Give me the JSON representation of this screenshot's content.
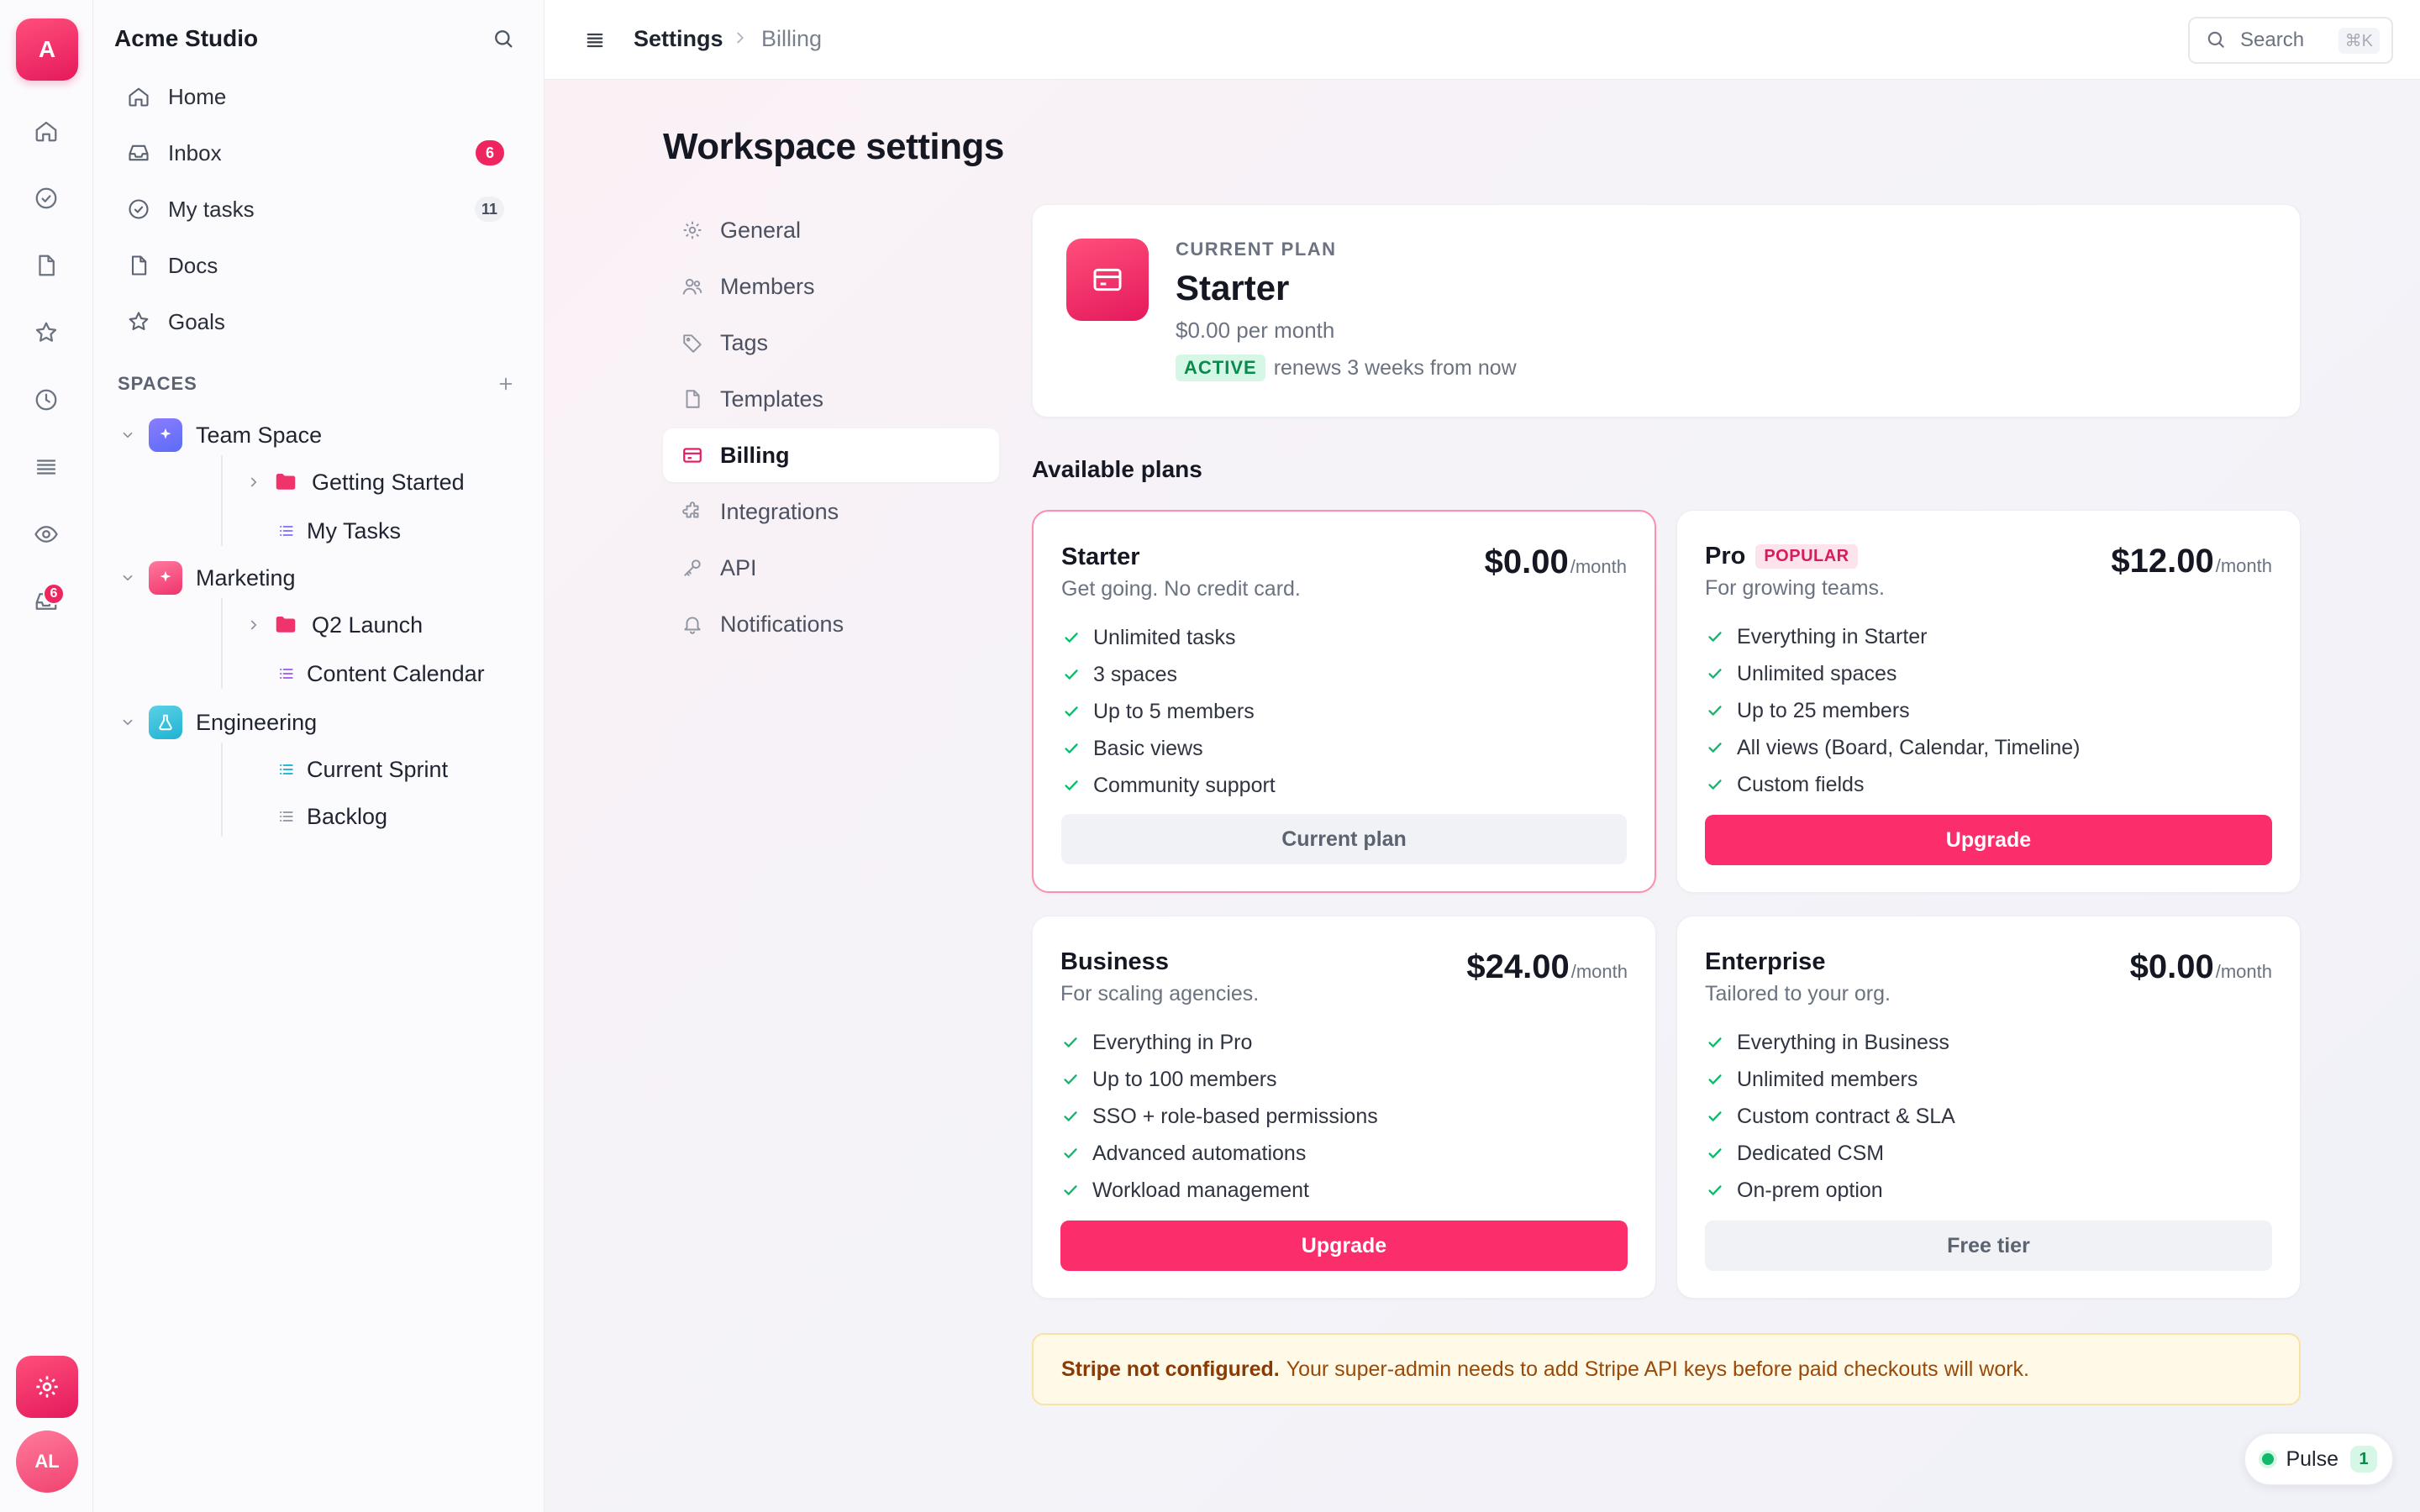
{
  "app": {
    "workspace_initial": "A",
    "workspace_name": "Acme Studio",
    "user_initials": "AL",
    "accent_color": "#fc2d6b"
  },
  "rail": {
    "inbox_badge": "6"
  },
  "sidebar": {
    "nav": [
      {
        "label": "Home",
        "icon": "home-icon"
      },
      {
        "label": "Inbox",
        "icon": "inbox-icon",
        "count": "6"
      },
      {
        "label": "My tasks",
        "icon": "check-circle-icon",
        "count": "11"
      },
      {
        "label": "Docs",
        "icon": "document-icon"
      },
      {
        "label": "Goals",
        "icon": "star-icon"
      }
    ],
    "spaces_label": "SPACES",
    "spaces": [
      {
        "label": "Team Space",
        "children": [
          "Getting Started",
          "My Tasks"
        ]
      },
      {
        "label": "Marketing",
        "children": [
          "Q2 Launch",
          "Content Calendar"
        ]
      },
      {
        "label": "Engineering",
        "children": [
          "Current Sprint",
          "Backlog"
        ]
      }
    ]
  },
  "topbar": {
    "crumb_root": "Settings",
    "crumb_current": "Billing",
    "search_label": "Search",
    "search_shortcut": "⌘K"
  },
  "page": {
    "title": "Workspace settings",
    "settings_nav": [
      {
        "label": "General",
        "icon": "gear-icon"
      },
      {
        "label": "Members",
        "icon": "users-icon"
      },
      {
        "label": "Tags",
        "icon": "tag-icon"
      },
      {
        "label": "Templates",
        "icon": "document-icon"
      },
      {
        "label": "Billing",
        "icon": "credit-card-icon",
        "active": true
      },
      {
        "label": "Integrations",
        "icon": "puzzle-icon"
      },
      {
        "label": "API",
        "icon": "key-icon"
      },
      {
        "label": "Notifications",
        "icon": "bell-icon"
      }
    ]
  },
  "current_plan": {
    "eyebrow": "CURRENT PLAN",
    "name": "Starter",
    "price": "$0.00 per month",
    "status": "ACTIVE",
    "renewal": "renews 3 weeks from now"
  },
  "available": {
    "title": "Available plans",
    "plans": [
      {
        "name": "Starter",
        "desc": "Get going. No credit card.",
        "price": "$0.00",
        "per": "/month",
        "features": [
          "Unlimited tasks",
          "3 spaces",
          "Up to 5 members",
          "Basic views",
          "Community support"
        ],
        "button": "Current plan"
      },
      {
        "name": "Pro",
        "badge": "POPULAR",
        "desc": "For growing teams.",
        "price": "$12.00",
        "per": "/month",
        "features": [
          "Everything in Starter",
          "Unlimited spaces",
          "Up to 25 members",
          "All views (Board, Calendar, Timeline)",
          "Custom fields"
        ],
        "button": "Upgrade"
      },
      {
        "name": "Business",
        "desc": "For scaling agencies.",
        "price": "$24.00",
        "per": "/month",
        "features": [
          "Everything in Pro",
          "Up to 100 members",
          "SSO + role-based permissions",
          "Advanced automations",
          "Workload management"
        ],
        "button": "Upgrade"
      },
      {
        "name": "Enterprise",
        "desc": "Tailored to your org.",
        "price": "$0.00",
        "per": "/month",
        "features": [
          "Everything in Business",
          "Unlimited members",
          "Custom contract & SLA",
          "Dedicated CSM",
          "On-prem option"
        ],
        "button": "Free tier"
      }
    ]
  },
  "warning": {
    "title": "Stripe not configured.",
    "text": "Your super-admin needs to add Stripe API keys before paid checkouts will work."
  },
  "pulse": {
    "label": "Pulse",
    "count": "1"
  }
}
